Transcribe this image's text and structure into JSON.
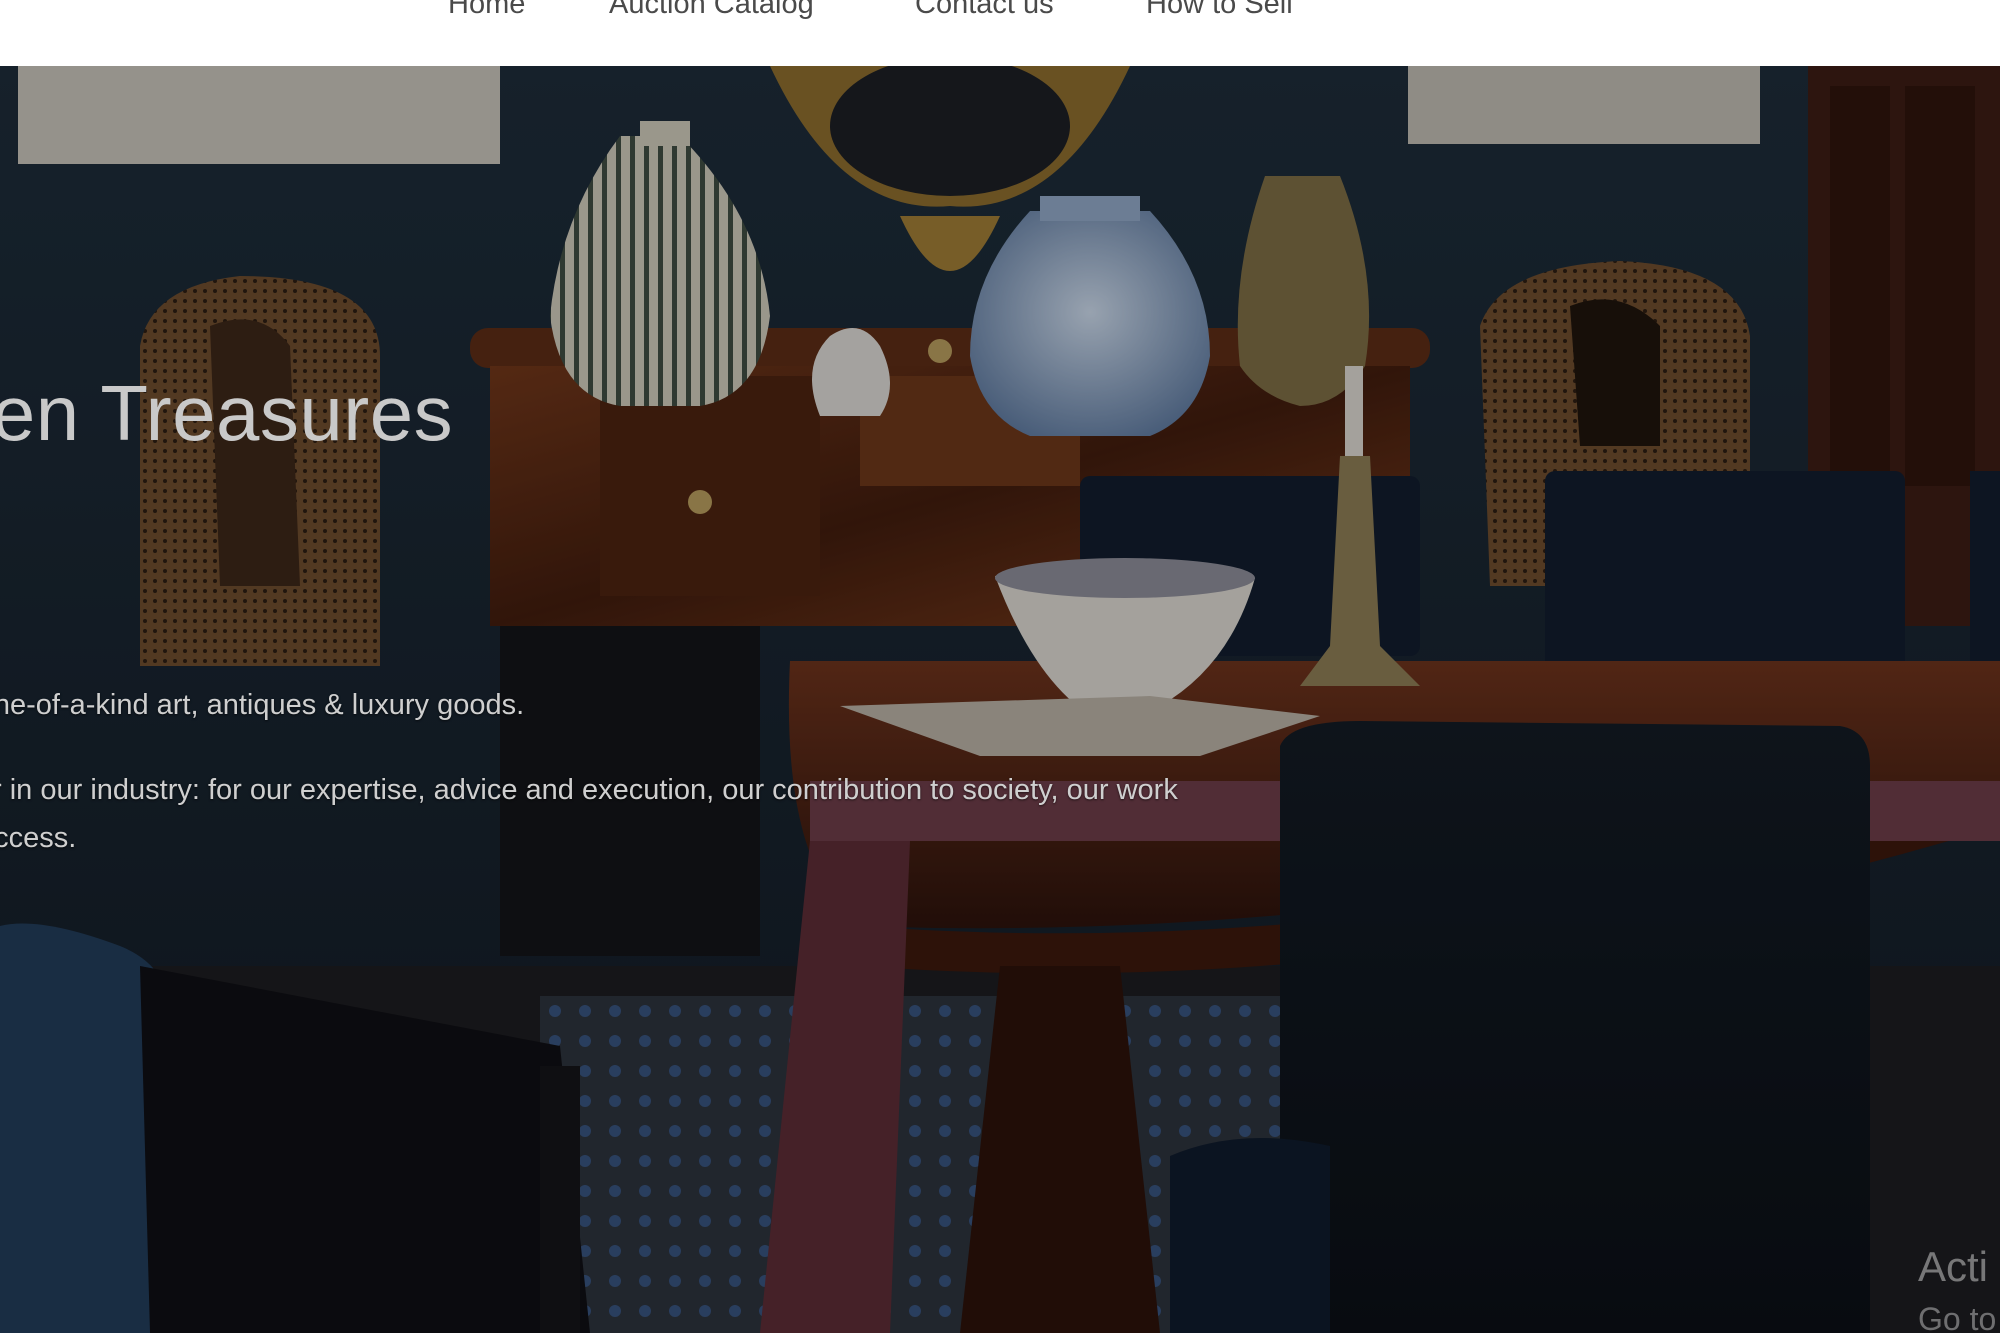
{
  "nav": {
    "items": [
      "Home",
      "Auction Catalog",
      "Contact us",
      "How to Sell"
    ]
  },
  "hero": {
    "heading": "den Treasures",
    "lines": [
      "r one-of-a-kind art, antiques & luxury goods.",
      "r in our industry: for our expertise, advice and execution, our contribution to society, our work",
      "uccess."
    ],
    "image_icon": "dining-room-antiques-photo"
  },
  "activation": {
    "title": "Acti",
    "subtitle": "Go to"
  },
  "colors": {
    "nav_bg": "#ffffff",
    "nav_text": "#4a4a4a",
    "hero_text": "#cfcfcf",
    "wall": "#1b2a36",
    "wood": "#5a2a14"
  }
}
